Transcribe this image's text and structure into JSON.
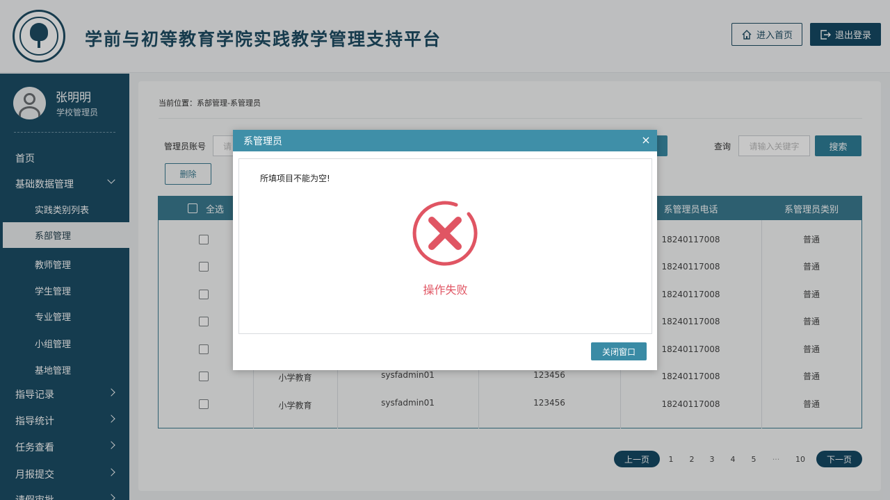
{
  "header": {
    "title": "学前与初等教育学院实践教学管理支持平台",
    "home_label": "进入首页",
    "logout_label": "退出登录"
  },
  "user": {
    "name": "张明明",
    "role": "学校管理员"
  },
  "sidebar": {
    "items": [
      {
        "label": "首页"
      },
      {
        "label": "基础数据管理"
      },
      {
        "label": "实践类别列表"
      },
      {
        "label": "系部管理"
      },
      {
        "label": "教师管理"
      },
      {
        "label": "学生管理"
      },
      {
        "label": "专业管理"
      },
      {
        "label": "小组管理"
      },
      {
        "label": "基地管理"
      },
      {
        "label": "指导记录"
      },
      {
        "label": "指导统计"
      },
      {
        "label": "任务查看"
      },
      {
        "label": "月报提交"
      },
      {
        "label": "请假审批"
      }
    ]
  },
  "main": {
    "breadcrumb": "当前位置：系部管理-系管理员",
    "filter_label": "管理员账号",
    "filter_placeholder": "请",
    "query_label": "查询",
    "query_placeholder": "请输入关键字",
    "search_label": "搜索",
    "delete_label": "删除"
  },
  "table": {
    "select_all": "全选",
    "headers": {
      "phone": "系管理员电话",
      "type": "系管理员类别"
    },
    "rows": [
      {
        "dept": "",
        "account": "",
        "password": "",
        "phone": "18240117008",
        "type": "普通"
      },
      {
        "dept": "",
        "account": "",
        "password": "",
        "phone": "18240117008",
        "type": "普通"
      },
      {
        "dept": "",
        "account": "",
        "password": "",
        "phone": "18240117008",
        "type": "普通"
      },
      {
        "dept": "",
        "account": "",
        "password": "",
        "phone": "18240117008",
        "type": "普通"
      },
      {
        "dept": "",
        "account": "",
        "password": "",
        "phone": "18240117008",
        "type": "普通"
      },
      {
        "dept": "小学教育",
        "account": "sysfadmin01",
        "password": "123456",
        "phone": "18240117008",
        "type": "普通"
      },
      {
        "dept": "小学教育",
        "account": "sysfadmin01",
        "password": "123456",
        "phone": "18240117008",
        "type": "普通"
      }
    ]
  },
  "pagination": {
    "prev": "上一页",
    "next": "下一页",
    "pages": [
      "1",
      "2",
      "3",
      "4",
      "5",
      "···",
      "10"
    ]
  },
  "modal": {
    "title": "系管理员",
    "close_symbol": "×",
    "message": "所填项目不能为空!",
    "status": "操作失败",
    "close_button": "关闭窗口"
  },
  "colors": {
    "brand": "#1e4c63",
    "sidebar": "#1b4d66",
    "accent": "#3a8ba5",
    "error": "#e05563"
  }
}
